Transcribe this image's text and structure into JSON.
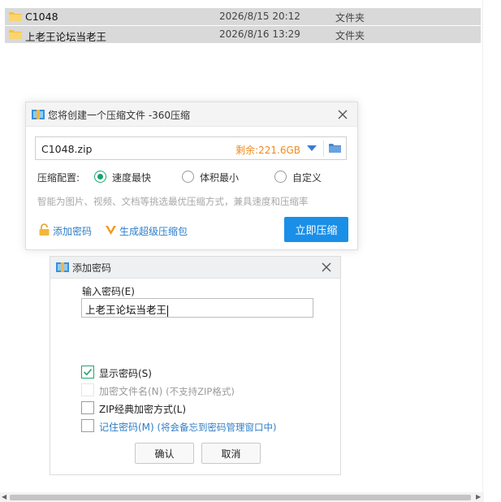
{
  "explorer": {
    "rows": [
      {
        "name": "C1048",
        "date": "2026/8/15 20:12",
        "type": "文件夹"
      },
      {
        "name": "上老王论坛当老王",
        "date": "2026/8/16 13:29",
        "type": "文件夹"
      }
    ]
  },
  "zip_dialog": {
    "title": "您将创建一个压缩文件 -360压缩",
    "filename": "C1048.zip",
    "space_remaining": "剩余:221.6GB",
    "config_label": "压缩配置:",
    "options": [
      "速度最快",
      "体积最小",
      "自定义"
    ],
    "selected_option": "速度最快",
    "hint": "智能为图片、视频、文档等挑选最优压缩方式，兼具速度和压缩率",
    "add_password": "添加密码",
    "super_pack": "生成超级压缩包",
    "compress_now": "立即压缩"
  },
  "password_dialog": {
    "title": "添加密码",
    "input_label": "输入密码(E)",
    "password_value": "上老王论坛当老王",
    "show_password": "显示密码(S)",
    "encrypt_filenames": "加密文件名(N)",
    "encrypt_filenames_note": "(不支持ZIP格式)",
    "zip_classic": "ZIP经典加密方式(L)",
    "remember_password": "记住密码(M)",
    "remember_password_note": "(将会备忘到密码管理窗口中)",
    "confirm": "确认",
    "cancel": "取消",
    "show_password_checked": true
  },
  "colors": {
    "accent_blue": "#1a8fe8",
    "link_blue": "#2d7dc8",
    "space_orange": "#f08a1c",
    "radio_green": "#15a36e"
  },
  "icons": [
    "folder-icon",
    "archive-app-icon",
    "close-icon",
    "dropdown-arrow-icon",
    "browse-folder-icon",
    "lock-icon",
    "v-logo-icon",
    "checkmark-icon"
  ]
}
